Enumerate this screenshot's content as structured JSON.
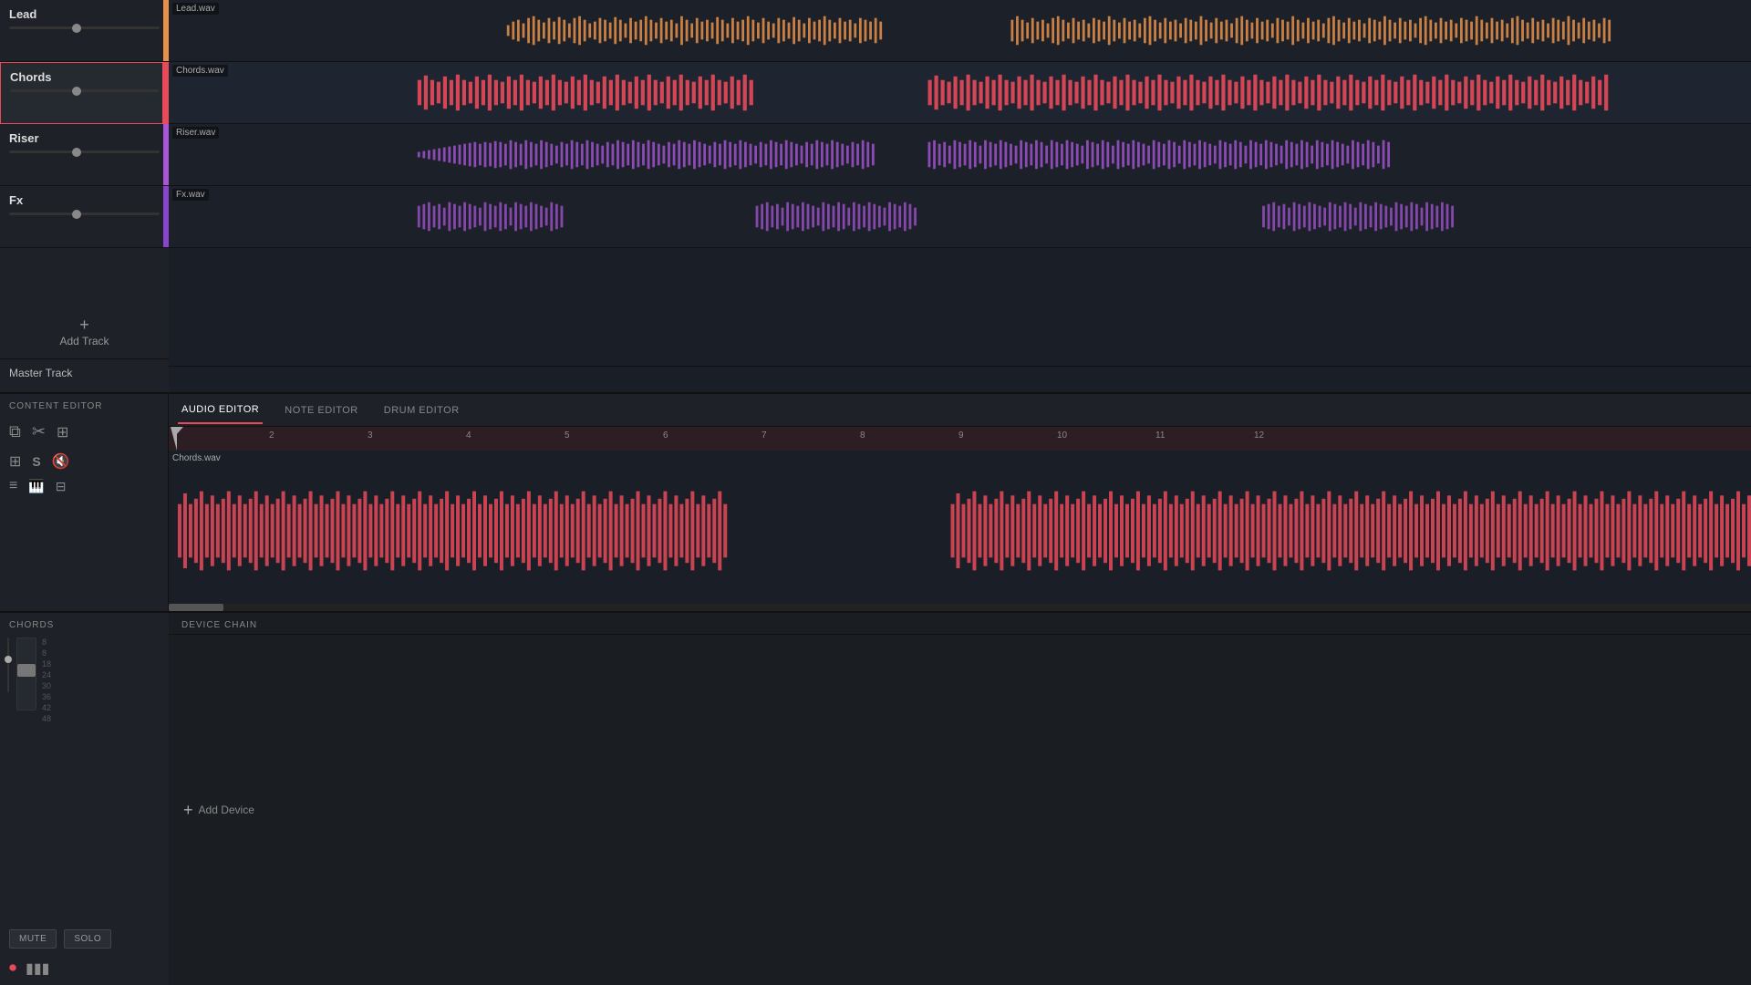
{
  "tracks": [
    {
      "id": "lead",
      "name": "Lead",
      "color": "orange",
      "indicator_class": "ind-lead",
      "clip_label": "Lead.wav",
      "fader_pos": "45%"
    },
    {
      "id": "chords",
      "name": "Chords",
      "color": "red",
      "indicator_class": "ind-chords",
      "clip_label": "Chords.wav",
      "selected": true,
      "fader_pos": "45%"
    },
    {
      "id": "riser",
      "name": "Riser",
      "color": "purple",
      "indicator_class": "ind-riser",
      "clip_label": "Riser.wav",
      "fader_pos": "45%"
    },
    {
      "id": "fx",
      "name": "Fx",
      "color": "darkpurple",
      "indicator_class": "ind-fx",
      "clip_label": "Fx.wav",
      "fader_pos": "45%"
    }
  ],
  "master_track": {
    "name": "Master Track"
  },
  "add_track_label": "Add Track",
  "editor_tabs": [
    {
      "id": "audio",
      "label": "Audio Editor",
      "active": true
    },
    {
      "id": "note",
      "label": "Note Editor",
      "active": false
    },
    {
      "id": "drum",
      "label": "Drum Editor",
      "active": false
    }
  ],
  "audio_editor": {
    "clip_name": "Chords.wav",
    "ruler_marks": [
      "2",
      "3",
      "4",
      "5",
      "6",
      "7",
      "8",
      "9",
      "10",
      "11",
      "12"
    ]
  },
  "bottom_panel": {
    "title": "CHORDS",
    "mute_label": "MUTE",
    "solo_label": "SOLO",
    "db_labels": [
      "8",
      "8",
      "18",
      "24",
      "30",
      "36",
      "42",
      "48"
    ]
  },
  "device_chain": {
    "title": "DEVICE CHAIN",
    "add_device_label": "Add Device"
  },
  "content_editor": {
    "title": "CONTENT EDITOR"
  }
}
